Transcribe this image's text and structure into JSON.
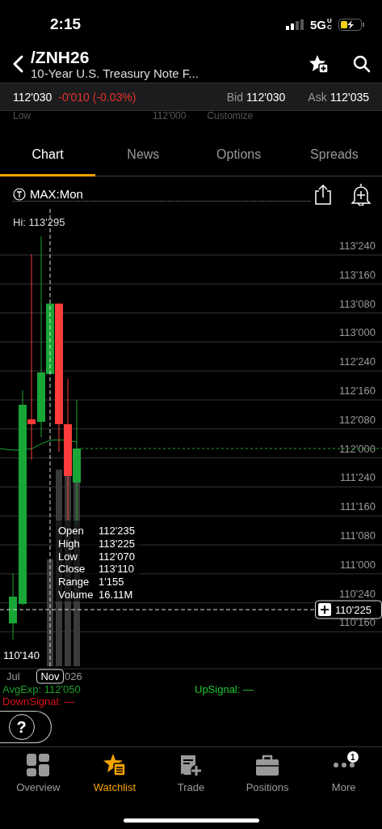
{
  "status_bar": {
    "time": "2:15",
    "network": "5G",
    "network_badge": "UC"
  },
  "header": {
    "symbol": "/ZNH26",
    "description": "10-Year U.S. Treasury Note F..."
  },
  "quote": {
    "last": "112'030",
    "change": "-0'010 (-0.03%)",
    "bid_label": "Bid",
    "bid": "112'030",
    "ask_label": "Ask",
    "ask": "112'035"
  },
  "covered_row": {
    "label": "Low",
    "value": "112'000",
    "action": "Customize"
  },
  "tabs": [
    {
      "label": "Chart",
      "selected": true
    },
    {
      "label": "News",
      "selected": false
    },
    {
      "label": "Options",
      "selected": false
    },
    {
      "label": "Spreads",
      "selected": false
    }
  ],
  "chart_toolbar": {
    "period": "MAX:Mon"
  },
  "chart": {
    "high_label": "Hi: 113'295",
    "low_label": "110'140",
    "y_labels": [
      "113'240",
      "113'160",
      "113'080",
      "113'000",
      "112'240",
      "112'160",
      "112'080",
      "112'000",
      "111'240",
      "111'160",
      "111'080",
      "111'000",
      "110'240",
      "110'160"
    ],
    "x_labels": [
      "Jul",
      "026"
    ],
    "crosshair_x_label": "Nov",
    "crosshair_price": "110'225",
    "tooltip": [
      {
        "label": "Open",
        "value": "112'235"
      },
      {
        "label": "High",
        "value": "113'225"
      },
      {
        "label": "Low",
        "value": "112'070"
      },
      {
        "label": "Close",
        "value": "113'110"
      },
      {
        "label": "Range",
        "value": "1'155"
      },
      {
        "label": "Volume",
        "value": "16.11M"
      }
    ]
  },
  "indicators": [
    {
      "text": "AvgExp: 112'050",
      "color": "#1e9e2a"
    },
    {
      "text": "UpSignal: —",
      "color": "#22c52e"
    },
    {
      "text": "DownSignal: —",
      "color": "#d9141a"
    }
  ],
  "help": "?",
  "nav": [
    {
      "label": "Overview",
      "selected": false
    },
    {
      "label": "Watchlist",
      "selected": true
    },
    {
      "label": "Trade",
      "selected": false
    },
    {
      "label": "Positions",
      "selected": false
    },
    {
      "label": "More",
      "selected": false,
      "badge": "1"
    }
  ]
}
